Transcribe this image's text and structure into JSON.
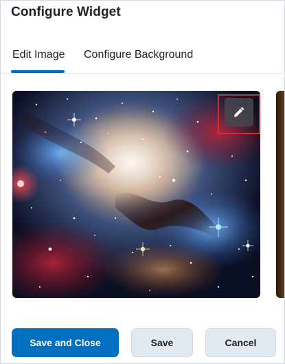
{
  "dialog": {
    "title": "Configure Widget"
  },
  "tabs": [
    {
      "label": "Edit Image",
      "active": true
    },
    {
      "label": "Configure Background",
      "active": false
    }
  ],
  "image": {
    "icon": "pencil-icon",
    "highlight_color": "#d0302b"
  },
  "footer": {
    "save_close_label": "Save and Close",
    "save_label": "Save",
    "cancel_label": "Cancel"
  },
  "colors": {
    "primary": "#006fbf",
    "secondary_bg": "#e3e9f1"
  }
}
